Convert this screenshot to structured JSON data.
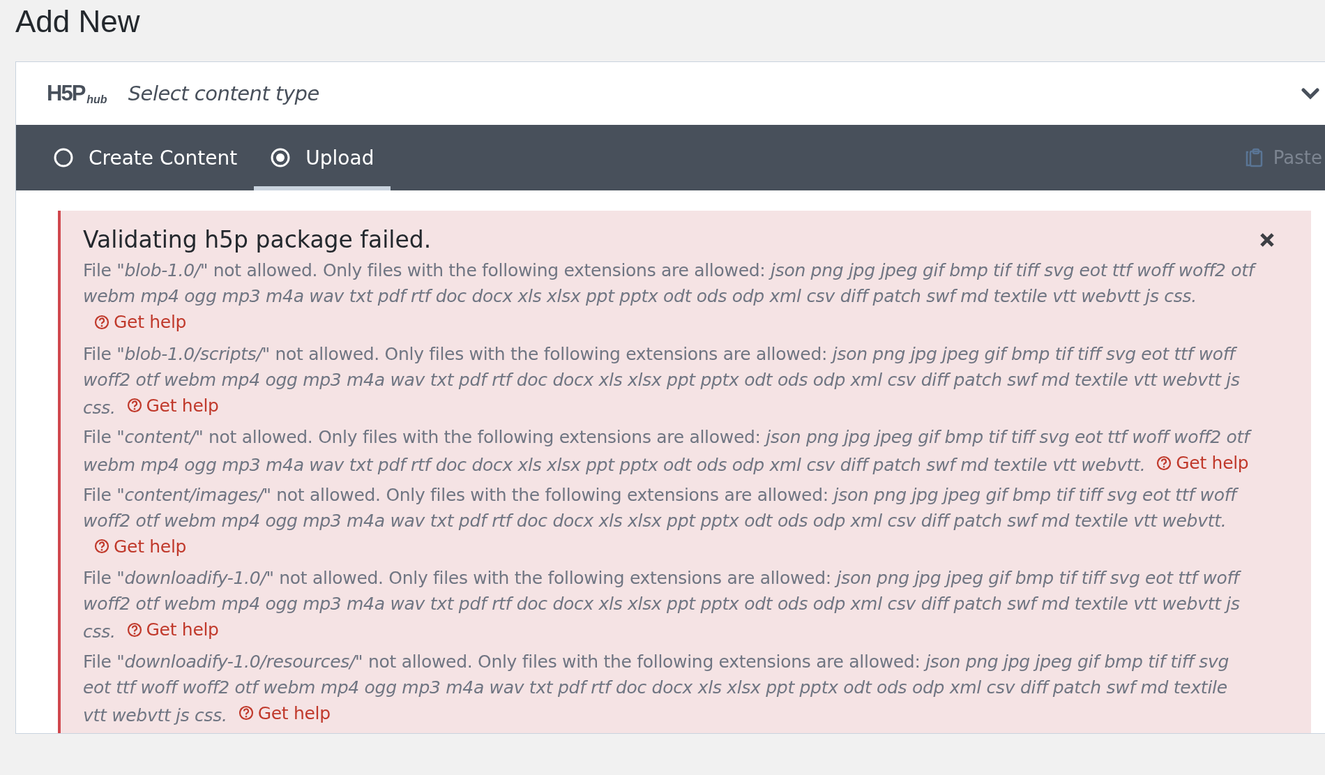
{
  "page_title": "Add New",
  "hub": {
    "logo": {
      "main": "H5P",
      "sub": "hub"
    },
    "select_label": "Select content type",
    "expanded": false
  },
  "tabs": [
    {
      "label": "Create Content",
      "selected": false
    },
    {
      "label": "Upload",
      "selected": true
    }
  ],
  "paste": {
    "label": "Paste",
    "disabled": true
  },
  "error": {
    "title": "Validating h5p package failed.",
    "messages": [
      {
        "text": "File \"*blob-1.0/*\" not allowed. Only files with the following extensions are allowed: *json png jpg jpeg gif bmp tif tiff svg eot ttf woff woff2 otf webm mp4 ogg mp3 m4a wav txt pdf rtf doc docx xls xlsx ppt pptx odt ods odp xml csv diff patch swf md textile vtt webvtt js css.*",
        "help": "Get help"
      },
      {
        "text": "File \"*blob-1.0/scripts/*\" not allowed. Only files with the following extensions are allowed: *json png jpg jpeg gif bmp tif tiff svg eot ttf woff woff2 otf webm mp4 ogg mp3 m4a wav txt pdf rtf doc docx xls xlsx ppt pptx odt ods odp xml csv diff patch swf md textile vtt webvtt js css.*",
        "help": "Get help"
      },
      {
        "text": "File \"*content/*\" not allowed. Only files with the following extensions are allowed: *json png jpg jpeg gif bmp tif tiff svg eot ttf woff woff2 otf webm mp4 ogg mp3 m4a wav txt pdf rtf doc docx xls xlsx ppt pptx odt ods odp xml csv diff patch swf md textile vtt webvtt.*",
        "help": "Get help"
      },
      {
        "text": "File \"*content/images/*\" not allowed. Only files with the following extensions are allowed: *json png jpg jpeg gif bmp tif tiff svg eot ttf woff woff2 otf webm mp4 ogg mp3 m4a wav txt pdf rtf doc docx xls xlsx ppt pptx odt ods odp xml csv diff patch swf md textile vtt webvtt.*",
        "help": "Get help"
      },
      {
        "text": "File \"*downloadify-1.0/*\" not allowed. Only files with the following extensions are allowed: *json png jpg jpeg gif bmp tif tiff svg eot ttf woff woff2 otf webm mp4 ogg mp3 m4a wav txt pdf rtf doc docx xls xlsx ppt pptx odt ods odp xml csv diff patch swf md textile vtt webvtt js css.*",
        "help": "Get help"
      },
      {
        "text": "File \"*downloadify-1.0/resources/*\" not allowed. Only files with the following extensions are allowed: *json png jpg jpeg gif bmp tif tiff svg eot ttf woff woff2 otf webm mp4 ogg mp3 m4a wav txt pdf rtf doc docx xls xlsx ppt pptx odt ods odp xml csv diff patch swf md textile vtt webvtt js css.*",
        "help": "Get help"
      }
    ]
  }
}
